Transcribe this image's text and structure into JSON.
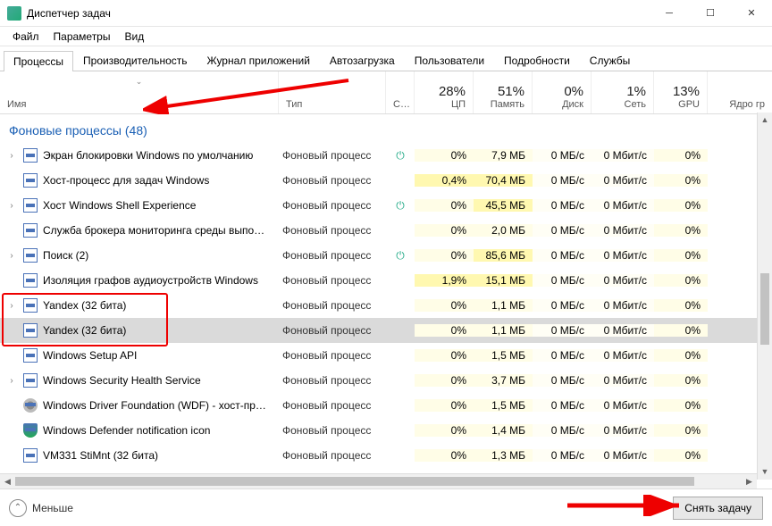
{
  "window": {
    "title": "Диспетчер задач"
  },
  "menu": [
    "Файл",
    "Параметры",
    "Вид"
  ],
  "tabs": [
    {
      "label": "Процессы",
      "active": true
    },
    {
      "label": "Производительность",
      "active": false
    },
    {
      "label": "Журнал приложений",
      "active": false
    },
    {
      "label": "Автозагрузка",
      "active": false
    },
    {
      "label": "Пользователи",
      "active": false
    },
    {
      "label": "Подробности",
      "active": false
    },
    {
      "label": "Службы",
      "active": false
    }
  ],
  "columns": {
    "name": "Имя",
    "type": "Тип",
    "status": "С…",
    "cpu": {
      "pct": "28%",
      "label": "ЦП"
    },
    "memory": {
      "pct": "51%",
      "label": "Память"
    },
    "disk": {
      "pct": "0%",
      "label": "Диск"
    },
    "network": {
      "pct": "1%",
      "label": "Сеть"
    },
    "gpu": {
      "pct": "13%",
      "label": "GPU"
    },
    "gpu_engine": "Ядро гр"
  },
  "group": {
    "title": "Фоновые процессы (48)"
  },
  "processes": [
    {
      "exp": true,
      "icon": "app",
      "name": "Экран блокировки Windows по умолчанию",
      "type": "Фоновый процесс",
      "status": "⏻",
      "cpu": "0%",
      "mem": "7,9 МБ",
      "disk": "0 МБ/с",
      "net": "0 Мбит/с",
      "gpu": "0%"
    },
    {
      "exp": false,
      "icon": "app",
      "name": "Хост-процесс для задач Windows",
      "type": "Фоновый процесс",
      "status": "",
      "cpu": "0,4%",
      "mem": "70,4 МБ",
      "disk": "0 МБ/с",
      "net": "0 Мбит/с",
      "gpu": "0%"
    },
    {
      "exp": true,
      "icon": "app",
      "name": "Хост Windows Shell Experience",
      "type": "Фоновый процесс",
      "status": "⏻",
      "cpu": "0%",
      "mem": "45,5 МБ",
      "disk": "0 МБ/с",
      "net": "0 Мбит/с",
      "gpu": "0%"
    },
    {
      "exp": false,
      "icon": "app",
      "name": "Служба брокера мониторинга среды выпо…",
      "type": "Фоновый процесс",
      "status": "",
      "cpu": "0%",
      "mem": "2,0 МБ",
      "disk": "0 МБ/с",
      "net": "0 Мбит/с",
      "gpu": "0%"
    },
    {
      "exp": true,
      "icon": "app",
      "name": "Поиск (2)",
      "type": "Фоновый процесс",
      "status": "⏻",
      "cpu": "0%",
      "mem": "85,6 МБ",
      "disk": "0 МБ/с",
      "net": "0 Мбит/с",
      "gpu": "0%"
    },
    {
      "exp": false,
      "icon": "app",
      "name": "Изоляция графов аудиоустройств Windows",
      "type": "Фоновый процесс",
      "status": "",
      "cpu": "1,9%",
      "mem": "15,1 МБ",
      "disk": "0 МБ/с",
      "net": "0 Мбит/с",
      "gpu": "0%"
    },
    {
      "exp": true,
      "icon": "app",
      "name": "Yandex (32 бита)",
      "type": "Фоновый процесс",
      "status": "",
      "cpu": "0%",
      "mem": "1,1 МБ",
      "disk": "0 МБ/с",
      "net": "0 Мбит/с",
      "gpu": "0%",
      "hl": true
    },
    {
      "exp": false,
      "icon": "app",
      "name": "Yandex (32 бита)",
      "type": "Фоновый процесс",
      "status": "",
      "cpu": "0%",
      "mem": "1,1 МБ",
      "disk": "0 МБ/с",
      "net": "0 Мбит/с",
      "gpu": "0%",
      "hl": true,
      "sel": true
    },
    {
      "exp": false,
      "icon": "app",
      "name": "Windows Setup API",
      "type": "Фоновый процесс",
      "status": "",
      "cpu": "0%",
      "mem": "1,5 МБ",
      "disk": "0 МБ/с",
      "net": "0 Мбит/с",
      "gpu": "0%"
    },
    {
      "exp": true,
      "icon": "app",
      "name": "Windows Security Health Service",
      "type": "Фоновый процесс",
      "status": "",
      "cpu": "0%",
      "mem": "3,7 МБ",
      "disk": "0 МБ/с",
      "net": "0 Мбит/с",
      "gpu": "0%"
    },
    {
      "exp": false,
      "icon": "gear",
      "name": "Windows Driver Foundation (WDF) - хост-пр…",
      "type": "Фоновый процесс",
      "status": "",
      "cpu": "0%",
      "mem": "1,5 МБ",
      "disk": "0 МБ/с",
      "net": "0 Мбит/с",
      "gpu": "0%"
    },
    {
      "exp": false,
      "icon": "shield",
      "name": "Windows Defender notification icon",
      "type": "Фоновый процесс",
      "status": "",
      "cpu": "0%",
      "mem": "1,4 МБ",
      "disk": "0 МБ/с",
      "net": "0 Мбит/с",
      "gpu": "0%"
    },
    {
      "exp": false,
      "icon": "app",
      "name": "VM331 StiMnt (32 бита)",
      "type": "Фоновый процесс",
      "status": "",
      "cpu": "0%",
      "mem": "1,3 МБ",
      "disk": "0 МБ/с",
      "net": "0 Мбит/с",
      "gpu": "0%"
    }
  ],
  "footer": {
    "fewer": "Меньше",
    "end_task": "Снять задачу"
  }
}
